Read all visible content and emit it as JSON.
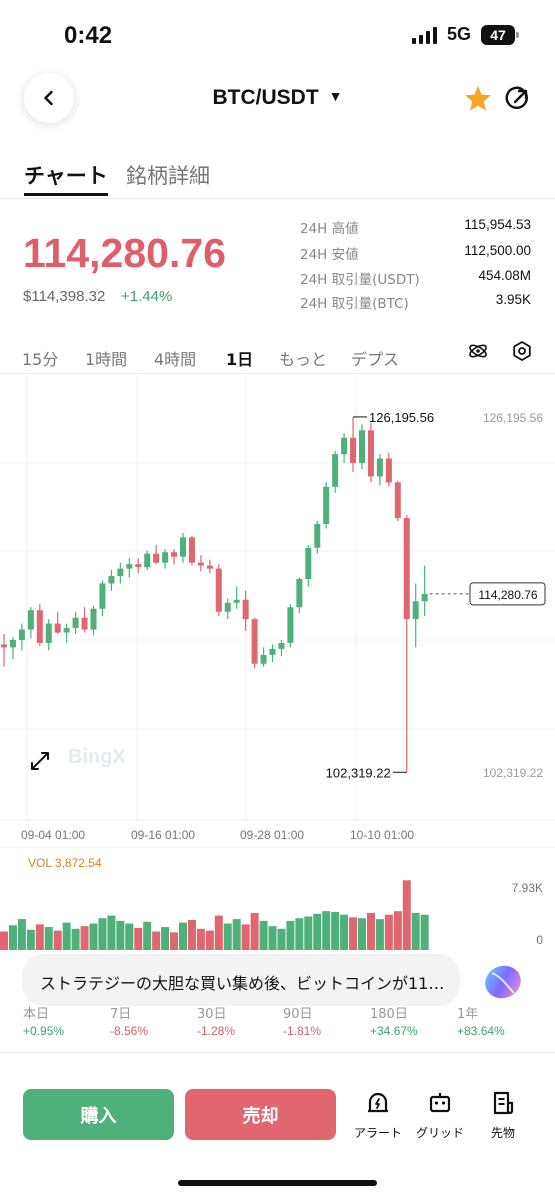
{
  "status_bar": {
    "time": "0:42",
    "network": "5G",
    "battery": "47"
  },
  "header": {
    "pair": "BTC/USDT",
    "caret": "▼",
    "icons": [
      "back-chevron-icon",
      "star-icon",
      "share-icon"
    ]
  },
  "tabs": [
    {
      "label": "チャート",
      "active": true
    },
    {
      "label": "銘柄詳細",
      "active": false
    }
  ],
  "price": {
    "last": "114,280.76",
    "usd": "$114,398.32",
    "change": "+1.44%"
  },
  "stats": [
    {
      "label": "24H 高値",
      "value": "115,954.53"
    },
    {
      "label": "24H 安値",
      "value": "112,500.00"
    },
    {
      "label": "24H 取引量(USDT)",
      "value": "454.08M"
    },
    {
      "label": "24H 取引量(BTC)",
      "value": "3.95K"
    }
  ],
  "timeframes": [
    {
      "label": "15分",
      "active": false
    },
    {
      "label": "1時間",
      "active": false
    },
    {
      "label": "4時間",
      "active": false
    },
    {
      "label": "1日",
      "active": true
    },
    {
      "label": "もっと",
      "active": false
    },
    {
      "label": "デプス",
      "active": false
    }
  ],
  "chart_data": {
    "type": "candlestick",
    "y_axis_labels": [
      "126,195.56",
      "102,319.22"
    ],
    "high_marker": "126,195.56",
    "low_marker": "102,319.22",
    "current_price": "114,280.76",
    "x_labels": [
      "09-04 01:00",
      "09-16 01:00",
      "09-28 01:00",
      "10-10 01:00"
    ],
    "watermark": "BingX",
    "up_color": "#4fb07a",
    "down_color": "#e06670",
    "candles": [
      [
        110900,
        111600,
        109400,
        110700
      ],
      [
        110700,
        111400,
        109900,
        111200
      ],
      [
        111200,
        112300,
        110500,
        111900
      ],
      [
        111900,
        113400,
        111300,
        113200
      ],
      [
        113200,
        113600,
        110800,
        111000
      ],
      [
        111000,
        112600,
        110500,
        112300
      ],
      [
        112300,
        113100,
        111600,
        111700
      ],
      [
        111700,
        112300,
        111000,
        112000
      ],
      [
        112000,
        113100,
        111600,
        112700
      ],
      [
        112700,
        113400,
        111700,
        111900
      ],
      [
        111900,
        113500,
        111500,
        113300
      ],
      [
        113300,
        115200,
        112800,
        115000
      ],
      [
        115000,
        115900,
        114500,
        115500
      ],
      [
        115500,
        116400,
        115000,
        116000
      ],
      [
        116000,
        116700,
        115400,
        116300
      ],
      [
        116300,
        116700,
        115700,
        116100
      ],
      [
        116100,
        117200,
        115900,
        117000
      ],
      [
        117000,
        117600,
        116300,
        116400
      ],
      [
        116400,
        117300,
        116000,
        117100
      ],
      [
        117100,
        117300,
        116300,
        116800
      ],
      [
        116800,
        118400,
        116400,
        118100
      ],
      [
        118100,
        118200,
        116200,
        116400
      ],
      [
        116400,
        116900,
        115800,
        116200
      ],
      [
        116200,
        116600,
        115700,
        116000
      ],
      [
        116000,
        116300,
        112800,
        113100
      ],
      [
        113100,
        114000,
        112600,
        113700
      ],
      [
        113700,
        114800,
        113300,
        113900
      ],
      [
        113900,
        114500,
        111800,
        112600
      ],
      [
        112600,
        112700,
        109300,
        109600
      ],
      [
        109600,
        110700,
        109400,
        110200
      ],
      [
        110200,
        110900,
        109700,
        110600
      ],
      [
        110600,
        111200,
        110100,
        111000
      ],
      [
        111000,
        113600,
        110700,
        113400
      ],
      [
        113400,
        115400,
        113000,
        115300
      ],
      [
        115300,
        117600,
        114800,
        117400
      ],
      [
        117400,
        119200,
        117000,
        119000
      ],
      [
        119000,
        121800,
        118700,
        121500
      ],
      [
        121500,
        123900,
        121100,
        123700
      ],
      [
        123700,
        125100,
        123100,
        124800
      ],
      [
        124800,
        126200,
        122500,
        123100
      ],
      [
        123100,
        125700,
        122700,
        125300
      ],
      [
        125300,
        125800,
        121800,
        122200
      ],
      [
        122200,
        123700,
        121600,
        123400
      ],
      [
        123400,
        123800,
        121500,
        121800
      ],
      [
        121800,
        121900,
        119200,
        119400
      ],
      [
        119400,
        119600,
        102300,
        112600
      ],
      [
        112600,
        115000,
        110700,
        113800
      ],
      [
        113800,
        116200,
        112800,
        114300
      ]
    ],
    "volume": {
      "label": "VOL 3,872.54",
      "max_label": "7.93K",
      "min_label": "0",
      "values": [
        2.1,
        2.8,
        3.5,
        2.3,
        2.9,
        2.6,
        2.2,
        3.1,
        2.4,
        2.7,
        3.0,
        3.6,
        3.9,
        3.3,
        3.0,
        2.5,
        3.2,
        2.1,
        2.6,
        2.0,
        3.1,
        3.4,
        2.4,
        2.2,
        3.9,
        3.0,
        3.5,
        2.9,
        4.2,
        3.3,
        2.7,
        2.4,
        3.3,
        3.6,
        3.8,
        4.1,
        4.4,
        4.3,
        4.0,
        3.7,
        3.6,
        4.2,
        3.5,
        4.0,
        4.4,
        7.9,
        4.2,
        4.0
      ]
    }
  },
  "news": {
    "text": "ストラテジーの大胆な買い集め後、ビットコインが11…"
  },
  "performance": [
    {
      "label": "本日",
      "value": "+0.95%",
      "up": true
    },
    {
      "label": "7日",
      "value": "-8.56%",
      "up": false
    },
    {
      "label": "30日",
      "value": "-1.28%",
      "up": false
    },
    {
      "label": "90日",
      "value": "-1.81%",
      "up": false
    },
    {
      "label": "180日",
      "value": "+34.67%",
      "up": true
    },
    {
      "label": "1年",
      "value": "+83.64%",
      "up": true
    }
  ],
  "bottom_bar": {
    "buy": "購入",
    "sell": "売却",
    "tools": [
      {
        "label": "アラート",
        "icon": "alert-icon"
      },
      {
        "label": "グリッド",
        "icon": "grid-bot-icon"
      },
      {
        "label": "先物",
        "icon": "futures-icon"
      }
    ]
  }
}
